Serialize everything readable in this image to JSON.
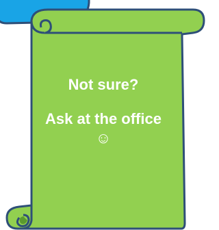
{
  "note": {
    "line1": "Not sure?",
    "line2": "Ask at the office ☺"
  },
  "colors": {
    "scroll_fill": "#92d050",
    "scroll_outline": "#2e4f78",
    "blue_shape_fill": "#19a4e6",
    "blue_shape_outline": "#2e4f78"
  }
}
